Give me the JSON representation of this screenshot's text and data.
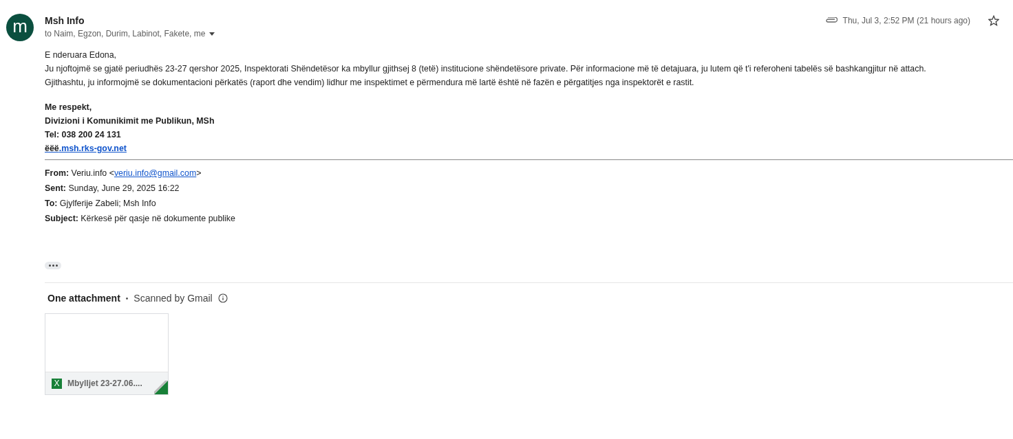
{
  "sender": {
    "avatar_letter": "m",
    "name": "Msh Info",
    "recipients": "to Naim, Egzon, Durim, Labinot, Fakete, me"
  },
  "meta": {
    "date": "Thu, Jul 3, 2:52 PM (21 hours ago)",
    "starred": false
  },
  "body": {
    "greeting": "E nderuara Edona,",
    "paragraphs": [
      "Ju njoftojmë se gjatë periudhës 23-27 qershor 2025, Inspektorati Shëndetësor ka mbyllur gjithsej 8 (tetë) institucione shëndetësore private. Për informacione më të detajuara, ju lutem që t'i referoheni tabelës së bashkangjitur në attach.",
      "Gjithashtu, ju informojmë se dokumentacioni përkatës (raport dhe vendim) lidhur me inspektimet e përmendura më lartë është në fazën e përgatitjes nga inspektorët e rastit."
    ],
    "signature": [
      "Me respekt,",
      "Divizioni i Komunikimit me Publikun, MSh",
      "Tel: 038 200 24 131"
    ],
    "website_prefix": "ëëë",
    "website_link": ".msh.rks-gov.net"
  },
  "quoted": {
    "from": {
      "label": "From:",
      "before": "Veriu.info <",
      "email": "veriu.info@gmail.com",
      "after": ">"
    },
    "fields": [
      {
        "label": "Sent:",
        "value": "Sunday, June 29, 2025 16:22"
      },
      {
        "label": "To:",
        "value": "Gjylferije Zabeli; Msh Info"
      },
      {
        "label": "Subject:",
        "value": "Kërkesë për qasje në dokumente publike"
      }
    ]
  },
  "attachments": {
    "title": "One attachment",
    "separator": "•",
    "scan_note": "Scanned by Gmail",
    "files": [
      {
        "type_letter": "X",
        "name": "Mbylljet 23-27.06...."
      }
    ]
  }
}
